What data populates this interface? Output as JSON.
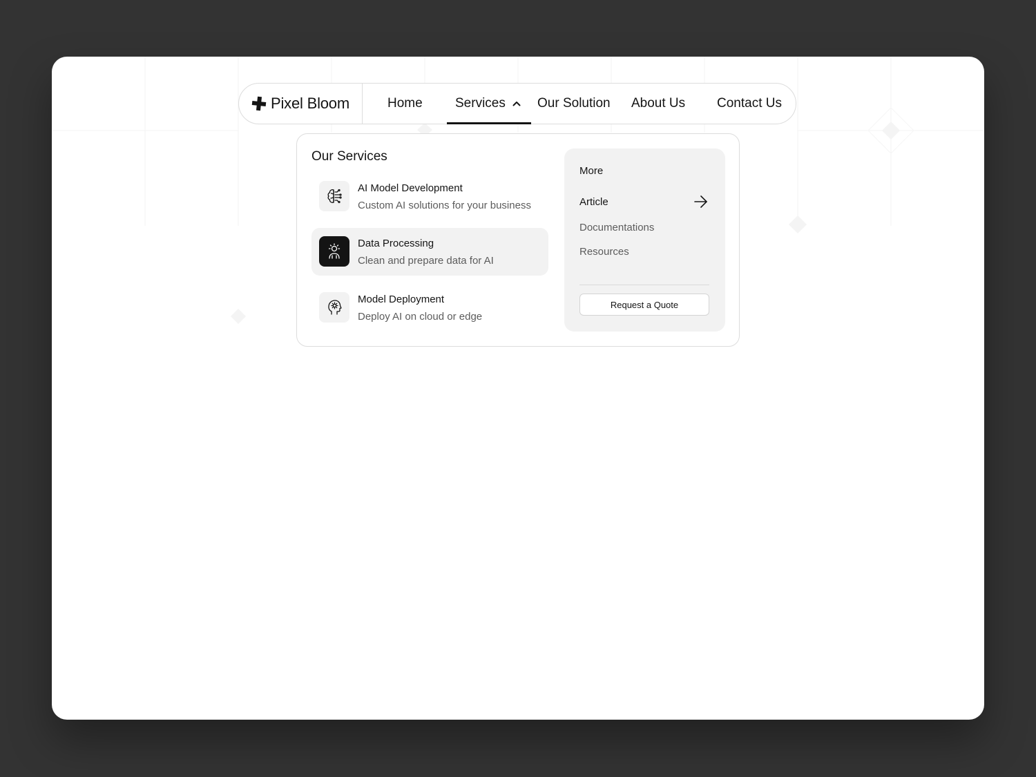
{
  "brand": {
    "name": "Pixel Bloom",
    "logo_icon": "plus-cross-logo"
  },
  "nav": {
    "items": [
      {
        "label": "Home"
      },
      {
        "label": "Services",
        "active": true,
        "expanded": true
      },
      {
        "label": "Our Solution"
      },
      {
        "label": "About Us"
      },
      {
        "label": "Contact Us"
      }
    ]
  },
  "dropdown": {
    "title": "Our Services",
    "services": [
      {
        "title": "AI Model Development",
        "description": "Custom AI solutions for your business",
        "icon": "circuit-brain-icon"
      },
      {
        "title": "Data Processing",
        "description": "Clean and prepare data for AI",
        "icon": "user-idea-icon",
        "highlighted": true
      },
      {
        "title": "Model Deployment",
        "description": "Deploy AI on cloud or edge",
        "icon": "head-gear-icon"
      }
    ],
    "more": {
      "label": "More",
      "links": [
        {
          "label": "Article",
          "icon": "arrow-right-icon"
        },
        {
          "label": "Documentations"
        },
        {
          "label": "Resources"
        }
      ],
      "cta_label": "Request a Quote"
    }
  },
  "colors": {
    "page_background": "#333333",
    "card_background": "#ffffff",
    "text_primary": "#141414",
    "text_secondary": "#5c5c5c",
    "panel_background": "#f2f2f2",
    "border": "#dcdcdc"
  }
}
